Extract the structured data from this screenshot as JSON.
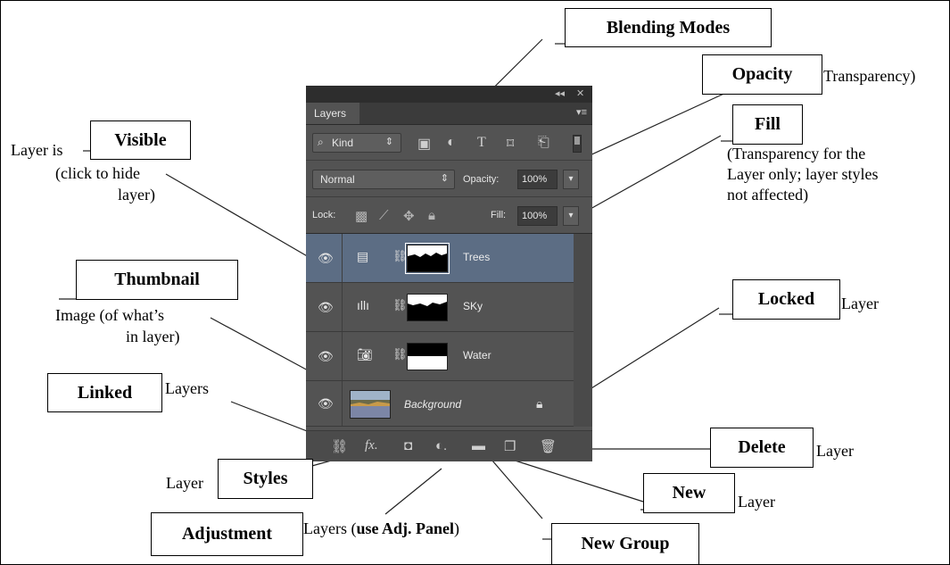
{
  "callouts": {
    "blending_modes": "Blending Modes",
    "opacity": "Opacity",
    "opacity_note": "Transparency)",
    "fill": "Fill",
    "fill_note_1": "(Transparency for the",
    "fill_note_2": "Layer only; layer styles",
    "fill_note_3": "not affected)",
    "visible": "Visible",
    "visible_pre": "Layer is",
    "visible_note_1": "(click to hide",
    "visible_note_2": "layer)",
    "thumbnail": "Thumbnail",
    "thumbnail_note_1": "Image (of what’s",
    "thumbnail_note_2": "in layer)",
    "locked": "Locked",
    "locked_note": "Layer",
    "linked": "Linked",
    "linked_note": "Layers",
    "delete": "Delete",
    "delete_note": "Layer",
    "styles_pre": "Layer",
    "styles": "Styles",
    "new": "New",
    "new_note": "Layer",
    "adjustment": "Adjustment",
    "adjustment_note_1": "Layers (",
    "adjustment_note_bold": "use Adj. Panel",
    "adjustment_note_2": ")",
    "new_group": "New Group"
  },
  "panel": {
    "tab": "Layers",
    "filter_kind": "Kind",
    "blend_mode": "Normal",
    "opacity_label": "Opacity:",
    "opacity_value": "100%",
    "lock_label": "Lock:",
    "fill_label": "Fill:",
    "fill_value": "100%",
    "layers": [
      {
        "name": "Trees",
        "selected": true
      },
      {
        "name": "SKy",
        "selected": false
      },
      {
        "name": "Water",
        "selected": false
      },
      {
        "name": "Background",
        "selected": false
      }
    ]
  },
  "icons": [
    "collapse-icon",
    "close-icon",
    "panel-menu-icon",
    "search-icon",
    "image-filter-icon",
    "adjustment-filter-icon",
    "type-filter-icon",
    "shape-filter-icon",
    "smart-object-filter-icon",
    "eye-icon",
    "link-icon",
    "lock-icon",
    "fx-icon",
    "mask-icon",
    "adjustment-icon",
    "folder-icon",
    "new-layer-icon",
    "trash-icon"
  ],
  "colors": {
    "panel": "#535353",
    "selected_layer": "#5c6d84"
  }
}
